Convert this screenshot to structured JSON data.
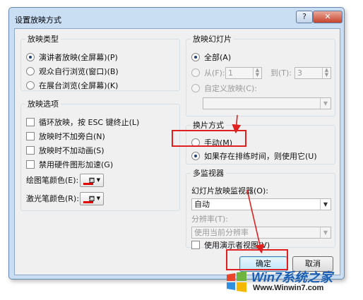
{
  "dialog": {
    "title": "设置放映方式",
    "help_label": "?",
    "close_label": "✕"
  },
  "show_type": {
    "legend": "放映类型",
    "options": [
      "演讲者放映(全屏幕)(P)",
      "观众自行浏览(窗口)(B)",
      "在展台浏览(全屏幕)(K)"
    ],
    "selected": 0
  },
  "show_options": {
    "legend": "放映选项",
    "checks": [
      "循环放映，按 ESC 键终止(L)",
      "放映时不加旁白(N)",
      "放映时不加动画(S)",
      "禁用硬件图形加速(G)"
    ],
    "pen_color_label": "绘图笔颜色(E):",
    "laser_color_label": "激光笔颜色(R):",
    "pen_color": "#e00000",
    "laser_color": "#e00000"
  },
  "slides": {
    "legend": "放映幻灯片",
    "all_label": "全部(A)",
    "from_label": "从(F):",
    "from_value": "1",
    "to_label": "到(T):",
    "to_value": "3",
    "custom_label": "自定义放映(C):",
    "custom_value": ""
  },
  "advance": {
    "legend": "换片方式",
    "manual_label": "手动(M)",
    "timings_label": "如果存在排练时间，则使用它(U)"
  },
  "monitors": {
    "legend": "多监视器",
    "monitor_label": "幻灯片放映监视器(O):",
    "monitor_value": "自动",
    "resolution_label": "分辨率(T):",
    "resolution_value": "使用当前分辨率",
    "presenter_view_label": "使用演示者视图(V)"
  },
  "buttons": {
    "ok": "确定",
    "cancel": "取消"
  },
  "watermark": {
    "brand": "Win7系统之家",
    "url": "Www.Winwin7.com"
  },
  "colors": {
    "annotation_red": "#e02020",
    "watermark_blue": "#1a5fb4"
  }
}
